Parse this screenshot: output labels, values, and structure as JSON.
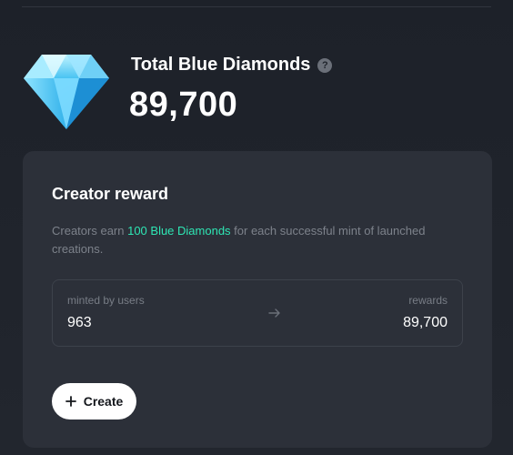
{
  "total": {
    "title": "Total Blue Diamonds",
    "help_icon": "?",
    "value": "89,700",
    "icon": "diamond-icon"
  },
  "card": {
    "title": "Creator reward",
    "description_prefix": "Creators earn ",
    "description_accent": "100 Blue Diamonds",
    "description_suffix": " for each successful mint of launched creations.",
    "minted_label": "minted by users",
    "minted_value": "963",
    "rewards_label": "rewards",
    "rewards_value": "89,700",
    "create_label": "Create"
  },
  "colors": {
    "background": "#1f232b",
    "card": "#2c3039",
    "accent": "#2ee6b4",
    "muted_text": "#7d828b",
    "button": "#ffffff"
  }
}
